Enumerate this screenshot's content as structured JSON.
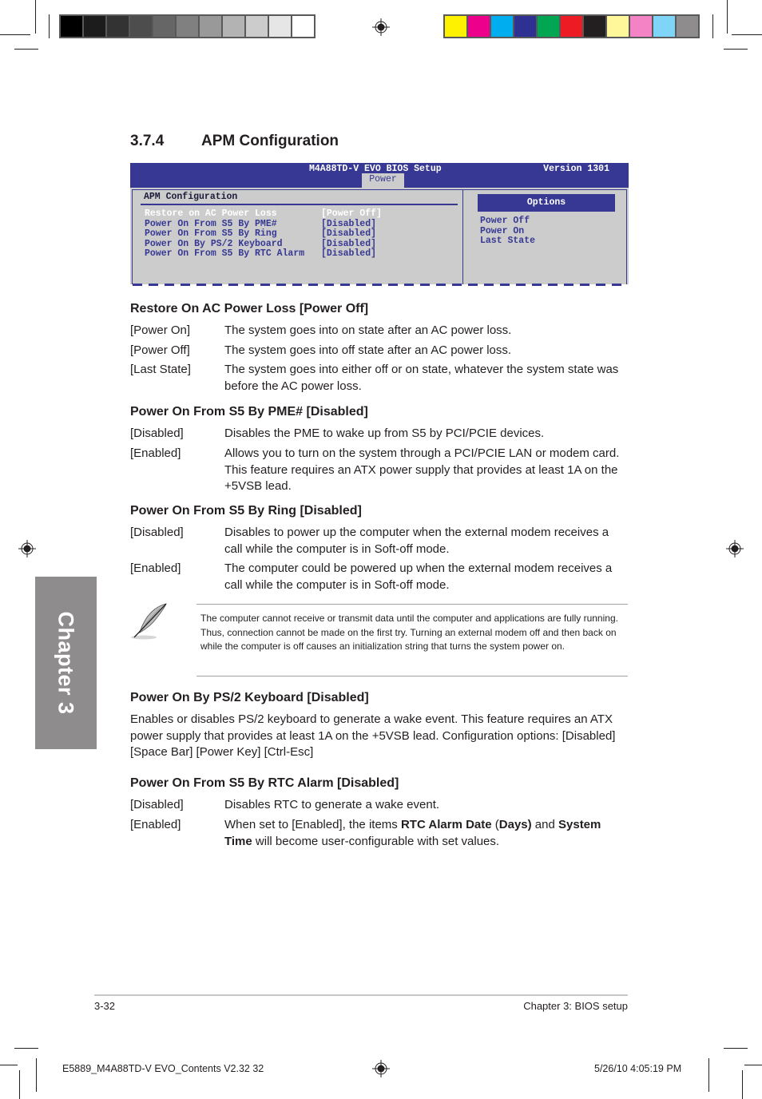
{
  "printer_marks": {
    "grayscale_swatches": [
      "#000000",
      "#1c1c1c",
      "#333333",
      "#4d4d4d",
      "#666666",
      "#808080",
      "#999999",
      "#b3b3b3",
      "#cccccc",
      "#e6e6e6",
      "#ffffff"
    ],
    "color_swatches": [
      "#fff200",
      "#ec008c",
      "#00aeef",
      "#2e3192",
      "#00a651",
      "#ed1c24",
      "#231f20",
      "#fff799",
      "#f383c5",
      "#7fd5f7",
      "#8e8c8d"
    ]
  },
  "section": {
    "number": "3.7.4",
    "title": "APM Configuration"
  },
  "bios": {
    "title": "M4A88TD-V EVO BIOS Setup",
    "version": "Version 1301",
    "active_tab": "Power",
    "section_label": "APM Configuration",
    "items": [
      {
        "label": "Restore on AC Power Loss",
        "value": "[Power Off]",
        "selected": true
      },
      {
        "label": "Power On From S5 By PME#",
        "value": "[Disabled]",
        "selected": false
      },
      {
        "label": "Power On From S5 By Ring",
        "value": "[Disabled]",
        "selected": false
      },
      {
        "label": "Power On By PS/2 Keyboard",
        "value": "[Disabled]",
        "selected": false
      },
      {
        "label": "Power On From S5 By RTC Alarm",
        "value": "[Disabled]",
        "selected": false
      }
    ],
    "options_header": "Options",
    "options": [
      "Power Off",
      "Power On",
      "Last State"
    ],
    "colors": {
      "accent": "#363893",
      "panel": "#cccccc",
      "highlight": "#ffffff"
    }
  },
  "sections": {
    "restore": {
      "heading": "Restore On AC Power Loss [Power Off]",
      "defs": [
        {
          "key": "[Power On]",
          "text": "The system goes into on state after an AC power loss."
        },
        {
          "key": "[Power Off]",
          "text": "The system goes into off state after an AC power loss."
        },
        {
          "key": "[Last State]",
          "text": "The system goes into either off or on state, whatever the system state was before the AC power loss."
        }
      ]
    },
    "pme": {
      "heading": "Power On From S5 By PME# [Disabled]",
      "defs": [
        {
          "key": "[Disabled]",
          "text": "Disables the PME to wake up from S5 by PCI/PCIE devices."
        },
        {
          "key": "[Enabled]",
          "text": "Allows you to turn on the system through a PCI/PCIE LAN or modem card. This feature requires an ATX power supply that provides at least 1A on the +5VSB lead."
        }
      ]
    },
    "ring": {
      "heading": "Power On From S5 By Ring [Disabled]",
      "defs": [
        {
          "key": "[Disabled]",
          "text": "Disables to power up the computer when the external modem receives a call while the computer is in Soft-off mode."
        },
        {
          "key": "[Enabled]",
          "text": "The computer could be powered up when the external modem receives a call while the computer is in Soft-off mode."
        }
      ]
    },
    "note": {
      "icon": "feather-pen-icon",
      "text": "The computer cannot receive or transmit data until the computer and applications are fully running. Thus, connection cannot be made on the first try. Turning an external modem off and then back on while the computer is off causes an initialization string that turns the system power on."
    },
    "ps2": {
      "heading": "Power On By PS/2 Keyboard [Disabled]",
      "text": "Enables or disables PS/2 keyboard to generate a wake event. This feature requires an ATX power supply that provides at least 1A on the +5VSB lead. Configuration options: [Disabled] [Space Bar] [Power Key] [Ctrl-Esc]"
    },
    "rtc": {
      "heading": "Power On From S5 By RTC Alarm [Disabled]",
      "defs": [
        {
          "key": "[Disabled]",
          "text": "Disables RTC to generate a wake event."
        },
        {
          "key": "[Enabled]",
          "parts": {
            "a": "When set to [Enabled], the items ",
            "b1": "RTC Alarm Date",
            "c": " (",
            "b2": "Days)",
            "d": " and ",
            "b3": "System Time",
            "e": " will become user-configurable with set values."
          }
        }
      ]
    }
  },
  "side_tab": {
    "label": "Chapter 3",
    "color": "#8e8c8d"
  },
  "footer": {
    "page_number": "3-32",
    "chapter": "Chapter 3: BIOS setup",
    "slug_file": "E5889_M4A88TD-V EVO_Contents V2.32   32",
    "slug_date": "5/26/10   4:05:19 PM"
  }
}
